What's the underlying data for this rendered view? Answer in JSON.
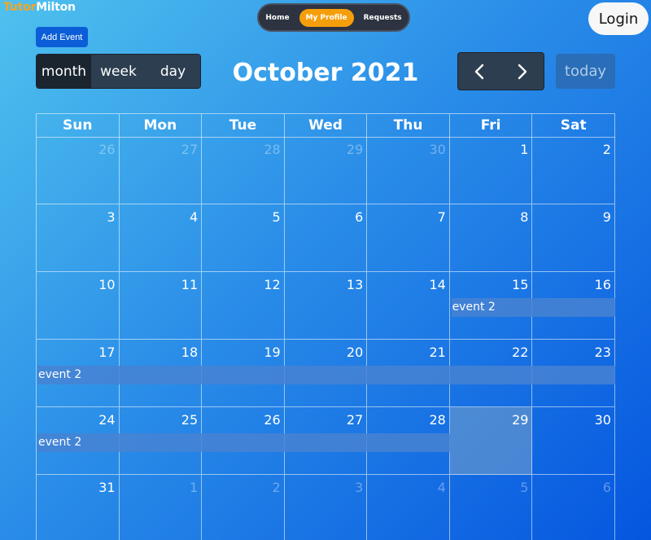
{
  "brand": {
    "part1": "Tutor",
    "part2": "Milton"
  },
  "nav": {
    "home": "Home",
    "profile": "My Profile",
    "requests": "Requests"
  },
  "login_label": "Login",
  "add_event_label": "Add Event",
  "views": {
    "month": "month",
    "week": "week",
    "day": "day"
  },
  "title": "October 2021",
  "today_label": "today",
  "weekdays": [
    "Sun",
    "Mon",
    "Tue",
    "Wed",
    "Thu",
    "Fri",
    "Sat"
  ],
  "weeks": [
    [
      "26",
      "27",
      "28",
      "29",
      "30",
      "1",
      "2"
    ],
    [
      "3",
      "4",
      "5",
      "6",
      "7",
      "8",
      "9"
    ],
    [
      "10",
      "11",
      "12",
      "13",
      "14",
      "15",
      "16"
    ],
    [
      "17",
      "18",
      "19",
      "20",
      "21",
      "22",
      "23"
    ],
    [
      "24",
      "25",
      "26",
      "27",
      "28",
      "29",
      "30"
    ],
    [
      "31",
      "1",
      "2",
      "3",
      "4",
      "5",
      "6"
    ]
  ],
  "events": [
    {
      "title": "event 2",
      "start": "2021-10-15",
      "end": "2021-10-29"
    }
  ],
  "colors": {
    "accent": "#f59e0b",
    "button_primary": "#0b5ed7",
    "toolbar_dark": "#2c3e50",
    "event_bg": "#4682d2"
  }
}
